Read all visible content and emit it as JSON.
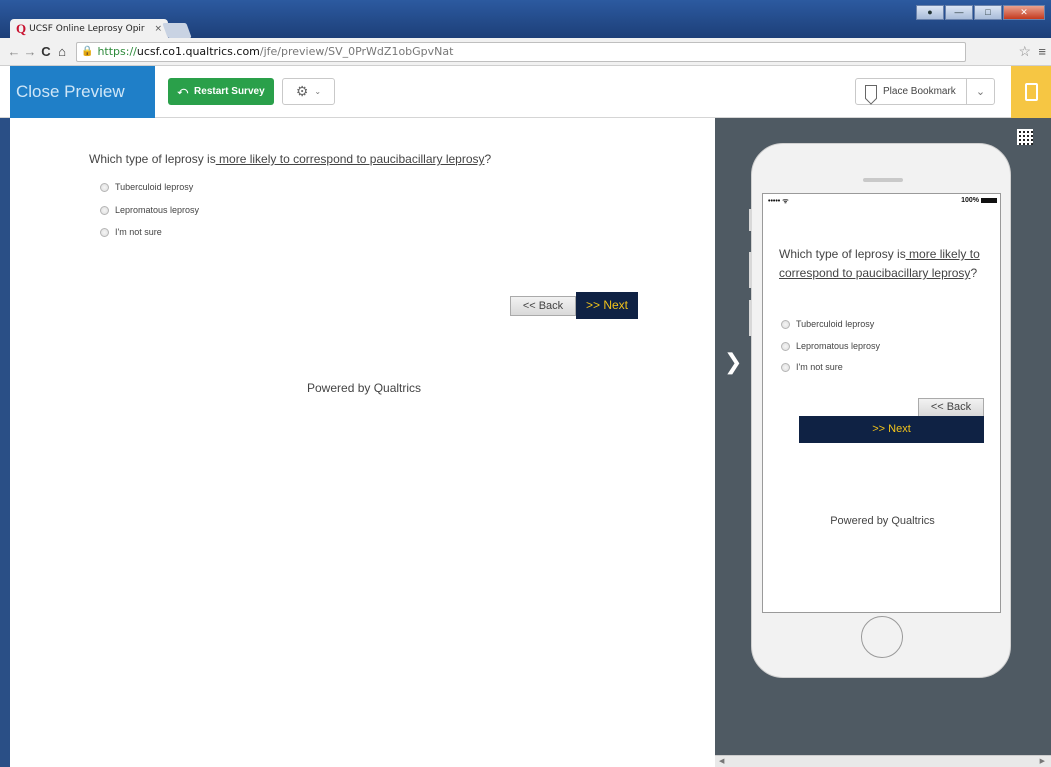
{
  "browser": {
    "tab_title": "UCSF Online Leprosy Opir",
    "tab_close": "×",
    "url_scheme": "https://",
    "url_host": "ucsf.co1.qualtrics.com",
    "url_path": "/jfe/preview/SV_0PrWdZ1obGpvNat"
  },
  "toolbar": {
    "close_preview": "Close Preview",
    "restart_survey": "Restart Survey",
    "place_bookmark": "Place Bookmark"
  },
  "survey": {
    "question_prefix": "Which type of leprosy is",
    "question_emphasis": " more likely to correspond to paucibacillary leprosy",
    "question_suffix": "?",
    "options": [
      "Tuberculoid leprosy",
      "Lepromatous leprosy",
      "I'm not sure"
    ],
    "back_label": "<< Back",
    "next_label": ">> Next",
    "powered_by": "Powered by Qualtrics"
  },
  "mobile": {
    "status_left": "••••• ᯤ",
    "status_right": "100%"
  },
  "colors": {
    "close_preview_bg": "#1f7fc8",
    "restart_bg": "#2aa04a",
    "next_bg": "#0f2244",
    "next_text": "#f2c31a",
    "mobile_toggle_bg": "#f6c643"
  }
}
